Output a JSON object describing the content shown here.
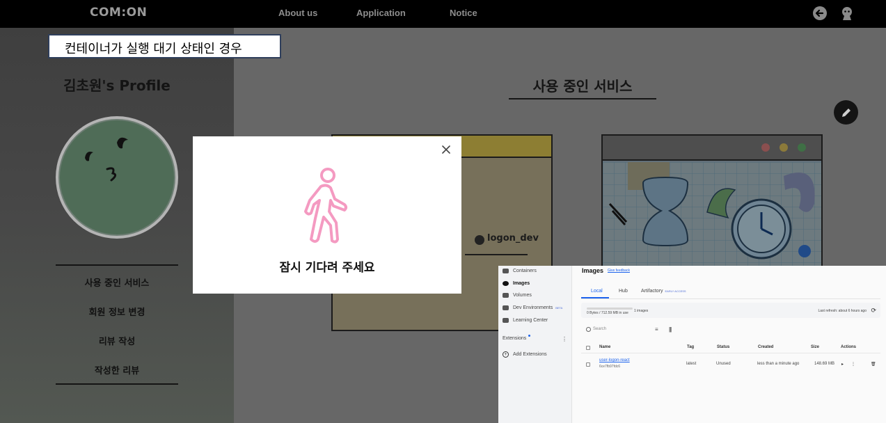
{
  "nav": {
    "logo": "COM:ON",
    "about": "About us",
    "application": "Application",
    "notice": "Notice",
    "icons": [
      "logout-icon",
      "user-icon"
    ]
  },
  "caption": "컨테이너가 실행 대기 상태인 경우",
  "profile": {
    "title": "김초원's Profile",
    "menu": [
      "사용 중인 서비스",
      "회원 정보 변경",
      "리뷰 작성",
      "작성한 리뷰"
    ]
  },
  "services": {
    "title": "사용 중인 서비스",
    "card1_user": "logon_dev"
  },
  "modal": {
    "message": "잠시 기다려 주세요",
    "icon": "walking-person-icon",
    "icon_color": "#f49ac1"
  },
  "docker": {
    "sidebar": {
      "containers": "Containers",
      "images": "Images",
      "volumes": "Volumes",
      "dev_environments": "Dev Environments",
      "beta": "BETA",
      "learning_center": "Learning Center",
      "extensions": "Extensions",
      "add_extensions": "Add Extensions"
    },
    "title": "Images",
    "feedback": "Give feedback",
    "tabs": {
      "local": "Local",
      "hub": "Hub",
      "artifactory": "Artifactory",
      "early_access": "EARLY ACCESS"
    },
    "usage": "0 Bytes / 712.59 MB in use",
    "count": "1 images",
    "last_refresh": "Last refresh: about 6 hours ago",
    "search_placeholder": "Search",
    "columns": {
      "name": "Name",
      "tag": "Tag",
      "status": "Status",
      "created": "Created",
      "size": "Size",
      "actions": "Actions"
    },
    "row": {
      "name": "user-logon-react",
      "hash": "6ce7fb97fdc6",
      "tag": "latest",
      "status": "Unused",
      "created": "less than a minute ago",
      "size": "148.69 MB"
    },
    "accent": "#1d63ed"
  }
}
